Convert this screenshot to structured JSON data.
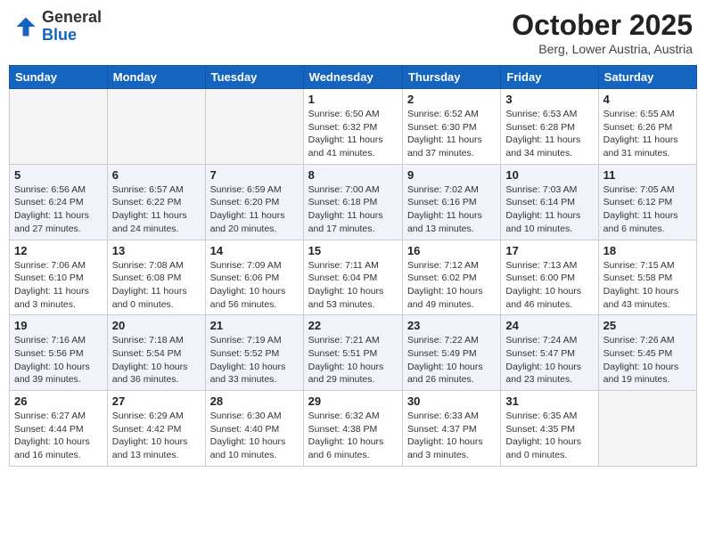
{
  "header": {
    "logo_general": "General",
    "logo_blue": "Blue",
    "month": "October 2025",
    "location": "Berg, Lower Austria, Austria"
  },
  "days_of_week": [
    "Sunday",
    "Monday",
    "Tuesday",
    "Wednesday",
    "Thursday",
    "Friday",
    "Saturday"
  ],
  "weeks": [
    [
      {
        "day": "",
        "info": ""
      },
      {
        "day": "",
        "info": ""
      },
      {
        "day": "",
        "info": ""
      },
      {
        "day": "1",
        "info": "Sunrise: 6:50 AM\nSunset: 6:32 PM\nDaylight: 11 hours and 41 minutes."
      },
      {
        "day": "2",
        "info": "Sunrise: 6:52 AM\nSunset: 6:30 PM\nDaylight: 11 hours and 37 minutes."
      },
      {
        "day": "3",
        "info": "Sunrise: 6:53 AM\nSunset: 6:28 PM\nDaylight: 11 hours and 34 minutes."
      },
      {
        "day": "4",
        "info": "Sunrise: 6:55 AM\nSunset: 6:26 PM\nDaylight: 11 hours and 31 minutes."
      }
    ],
    [
      {
        "day": "5",
        "info": "Sunrise: 6:56 AM\nSunset: 6:24 PM\nDaylight: 11 hours and 27 minutes."
      },
      {
        "day": "6",
        "info": "Sunrise: 6:57 AM\nSunset: 6:22 PM\nDaylight: 11 hours and 24 minutes."
      },
      {
        "day": "7",
        "info": "Sunrise: 6:59 AM\nSunset: 6:20 PM\nDaylight: 11 hours and 20 minutes."
      },
      {
        "day": "8",
        "info": "Sunrise: 7:00 AM\nSunset: 6:18 PM\nDaylight: 11 hours and 17 minutes."
      },
      {
        "day": "9",
        "info": "Sunrise: 7:02 AM\nSunset: 6:16 PM\nDaylight: 11 hours and 13 minutes."
      },
      {
        "day": "10",
        "info": "Sunrise: 7:03 AM\nSunset: 6:14 PM\nDaylight: 11 hours and 10 minutes."
      },
      {
        "day": "11",
        "info": "Sunrise: 7:05 AM\nSunset: 6:12 PM\nDaylight: 11 hours and 6 minutes."
      }
    ],
    [
      {
        "day": "12",
        "info": "Sunrise: 7:06 AM\nSunset: 6:10 PM\nDaylight: 11 hours and 3 minutes."
      },
      {
        "day": "13",
        "info": "Sunrise: 7:08 AM\nSunset: 6:08 PM\nDaylight: 11 hours and 0 minutes."
      },
      {
        "day": "14",
        "info": "Sunrise: 7:09 AM\nSunset: 6:06 PM\nDaylight: 10 hours and 56 minutes."
      },
      {
        "day": "15",
        "info": "Sunrise: 7:11 AM\nSunset: 6:04 PM\nDaylight: 10 hours and 53 minutes."
      },
      {
        "day": "16",
        "info": "Sunrise: 7:12 AM\nSunset: 6:02 PM\nDaylight: 10 hours and 49 minutes."
      },
      {
        "day": "17",
        "info": "Sunrise: 7:13 AM\nSunset: 6:00 PM\nDaylight: 10 hours and 46 minutes."
      },
      {
        "day": "18",
        "info": "Sunrise: 7:15 AM\nSunset: 5:58 PM\nDaylight: 10 hours and 43 minutes."
      }
    ],
    [
      {
        "day": "19",
        "info": "Sunrise: 7:16 AM\nSunset: 5:56 PM\nDaylight: 10 hours and 39 minutes."
      },
      {
        "day": "20",
        "info": "Sunrise: 7:18 AM\nSunset: 5:54 PM\nDaylight: 10 hours and 36 minutes."
      },
      {
        "day": "21",
        "info": "Sunrise: 7:19 AM\nSunset: 5:52 PM\nDaylight: 10 hours and 33 minutes."
      },
      {
        "day": "22",
        "info": "Sunrise: 7:21 AM\nSunset: 5:51 PM\nDaylight: 10 hours and 29 minutes."
      },
      {
        "day": "23",
        "info": "Sunrise: 7:22 AM\nSunset: 5:49 PM\nDaylight: 10 hours and 26 minutes."
      },
      {
        "day": "24",
        "info": "Sunrise: 7:24 AM\nSunset: 5:47 PM\nDaylight: 10 hours and 23 minutes."
      },
      {
        "day": "25",
        "info": "Sunrise: 7:26 AM\nSunset: 5:45 PM\nDaylight: 10 hours and 19 minutes."
      }
    ],
    [
      {
        "day": "26",
        "info": "Sunrise: 6:27 AM\nSunset: 4:44 PM\nDaylight: 10 hours and 16 minutes."
      },
      {
        "day": "27",
        "info": "Sunrise: 6:29 AM\nSunset: 4:42 PM\nDaylight: 10 hours and 13 minutes."
      },
      {
        "day": "28",
        "info": "Sunrise: 6:30 AM\nSunset: 4:40 PM\nDaylight: 10 hours and 10 minutes."
      },
      {
        "day": "29",
        "info": "Sunrise: 6:32 AM\nSunset: 4:38 PM\nDaylight: 10 hours and 6 minutes."
      },
      {
        "day": "30",
        "info": "Sunrise: 6:33 AM\nSunset: 4:37 PM\nDaylight: 10 hours and 3 minutes."
      },
      {
        "day": "31",
        "info": "Sunrise: 6:35 AM\nSunset: 4:35 PM\nDaylight: 10 hours and 0 minutes."
      },
      {
        "day": "",
        "info": ""
      }
    ]
  ]
}
